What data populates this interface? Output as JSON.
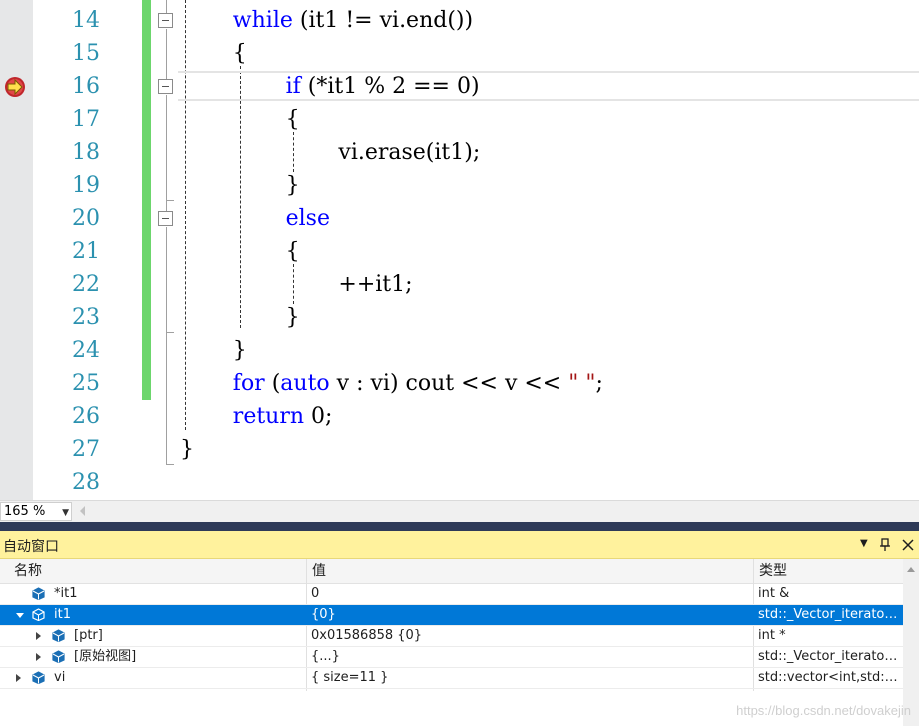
{
  "editor": {
    "line_numbers": [
      "14",
      "15",
      "16",
      "17",
      "18",
      "19",
      "20",
      "21",
      "22",
      "23",
      "24",
      "25",
      "26",
      "27",
      "28"
    ],
    "lines": [
      {
        "indent": 2,
        "tokens": [
          {
            "t": "while",
            "k": "kw"
          },
          {
            "t": " (it1 != vi.end())"
          }
        ]
      },
      {
        "indent": 2,
        "tokens": [
          {
            "t": "{"
          }
        ]
      },
      {
        "indent": 4,
        "tokens": [
          {
            "t": "if",
            "k": "kw"
          },
          {
            "t": " (*it1 % 2 == 0)"
          }
        ]
      },
      {
        "indent": 4,
        "tokens": [
          {
            "t": "{"
          }
        ]
      },
      {
        "indent": 6,
        "tokens": [
          {
            "t": "vi.erase(it1);"
          }
        ]
      },
      {
        "indent": 4,
        "tokens": [
          {
            "t": "}"
          }
        ]
      },
      {
        "indent": 4,
        "tokens": [
          {
            "t": "else",
            "k": "kw"
          }
        ]
      },
      {
        "indent": 4,
        "tokens": [
          {
            "t": "{"
          }
        ]
      },
      {
        "indent": 6,
        "tokens": [
          {
            "t": "++it1;"
          }
        ]
      },
      {
        "indent": 4,
        "tokens": [
          {
            "t": "}"
          }
        ]
      },
      {
        "indent": 2,
        "tokens": [
          {
            "t": "}"
          }
        ]
      },
      {
        "indent": 2,
        "tokens": [
          {
            "t": "for",
            "k": "kw"
          },
          {
            "t": " ("
          },
          {
            "t": "auto",
            "k": "kw"
          },
          {
            "t": " v : vi) cout << v << "
          },
          {
            "t": "\" \"",
            "k": "str"
          },
          {
            "t": ";"
          }
        ]
      },
      {
        "indent": 2,
        "tokens": [
          {
            "t": "return",
            "k": "kw"
          },
          {
            "t": " 0;"
          }
        ]
      },
      {
        "indent": 0,
        "tokens": [
          {
            "t": "}"
          }
        ]
      },
      {
        "indent": 0,
        "tokens": []
      }
    ],
    "current_line": "16",
    "zoom": "165 %"
  },
  "autos": {
    "title": "自动窗口",
    "pin_icon": "pin-icon",
    "close_icon": "close-icon",
    "columns": {
      "name": "名称",
      "value": "值",
      "type": "类型"
    },
    "rows": [
      {
        "name": "*it1",
        "value": "0",
        "type": "int &",
        "level": 0,
        "expander": "none",
        "selected": false
      },
      {
        "name": "it1",
        "value": "{0}",
        "type": "std::_Vector_iterator<std::_Vector_val<std::_Simple_types<int> > >",
        "level": 0,
        "expander": "expanded",
        "selected": true
      },
      {
        "name": "[ptr]",
        "value": "0x01586858 {0}",
        "type": "int *",
        "level": 1,
        "expander": "collapsed",
        "selected": false
      },
      {
        "name": "[原始视图]",
        "value": "{...}",
        "type": "std::_Vector_iterator<std::_Vector_val<std::_Simple_types<int> > >",
        "level": 1,
        "expander": "collapsed",
        "selected": false
      },
      {
        "name": "vi",
        "value": "{ size=11 }",
        "type": "std::vector<int,std::allocator<int> >",
        "level": 0,
        "expander": "collapsed",
        "selected": false
      }
    ]
  },
  "watermark": "https://blog.csdn.net/dovakejin",
  "colors": {
    "keyword": "#0000ff",
    "string": "#a31515",
    "line_number": "#2b91af",
    "change_bar": "#6cd66c",
    "panel_title": "#fff29d",
    "selection": "#0078d7"
  }
}
